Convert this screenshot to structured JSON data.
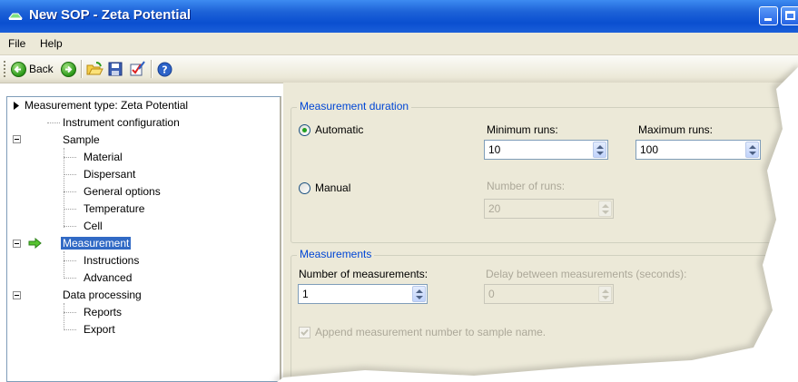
{
  "window": {
    "title": "New SOP - Zeta Potential"
  },
  "menu": {
    "items": [
      "File",
      "Help"
    ]
  },
  "toolbar": {
    "back_label": "Back"
  },
  "tree": {
    "root": "Measurement type: Zeta Potential",
    "instrument": "Instrument configuration",
    "sample": "Sample",
    "material": "Material",
    "dispersant": "Dispersant",
    "general_options": "General options",
    "temperature": "Temperature",
    "cell": "Cell",
    "measurement": "Measurement",
    "instructions": "Instructions",
    "advanced": "Advanced",
    "data_processing": "Data processing",
    "reports": "Reports",
    "export": "Export"
  },
  "duration": {
    "title": "Measurement duration",
    "automatic": "Automatic",
    "manual": "Manual",
    "selected": "Automatic",
    "min_runs_label": "Minimum runs:",
    "min_runs": "10",
    "max_runs_label": "Maximum runs:",
    "max_runs": "100",
    "num_runs_label": "Number of runs:",
    "num_runs": "20"
  },
  "measurements": {
    "title": "Measurements",
    "count_label": "Number of measurements:",
    "count": "1",
    "delay_label": "Delay between measurements (seconds):",
    "delay": "0",
    "append_label": "Append measurement number to sample name.",
    "append_checked": true
  },
  "colors": {
    "titlebar": "#0a4fd0",
    "selection": "#316ac5",
    "group_title": "#0046d5",
    "panel": "#ece9d8"
  }
}
